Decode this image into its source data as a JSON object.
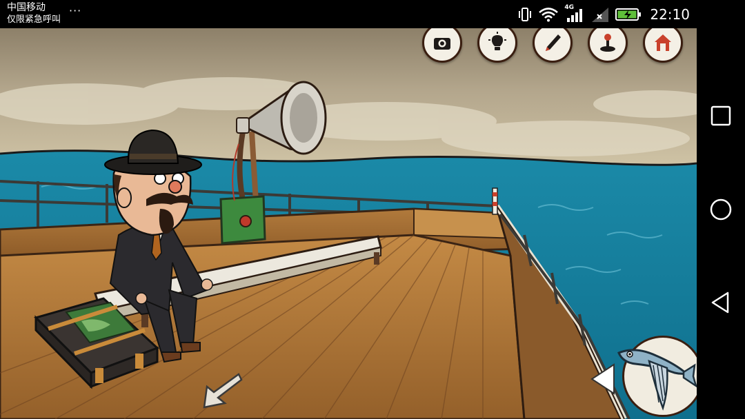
{
  "status_bar": {
    "carrier": "中国移动",
    "emergency_text": "仅限紧急呼叫",
    "more": "···",
    "network": "4G",
    "time": "22:10"
  },
  "game": {
    "toolbar": [
      "camera-icon",
      "lightbulb-icon",
      "pencil-icon",
      "joystick-icon",
      "home-icon",
      "partial-icon"
    ],
    "inventory_item": "flying-fish",
    "scene": {
      "sky_color": "#a79b84",
      "sea_color": "#1b8aa8",
      "deck_color": "#b9813e"
    }
  },
  "nav_bar": {
    "buttons": [
      "recent-apps",
      "home",
      "back"
    ]
  }
}
